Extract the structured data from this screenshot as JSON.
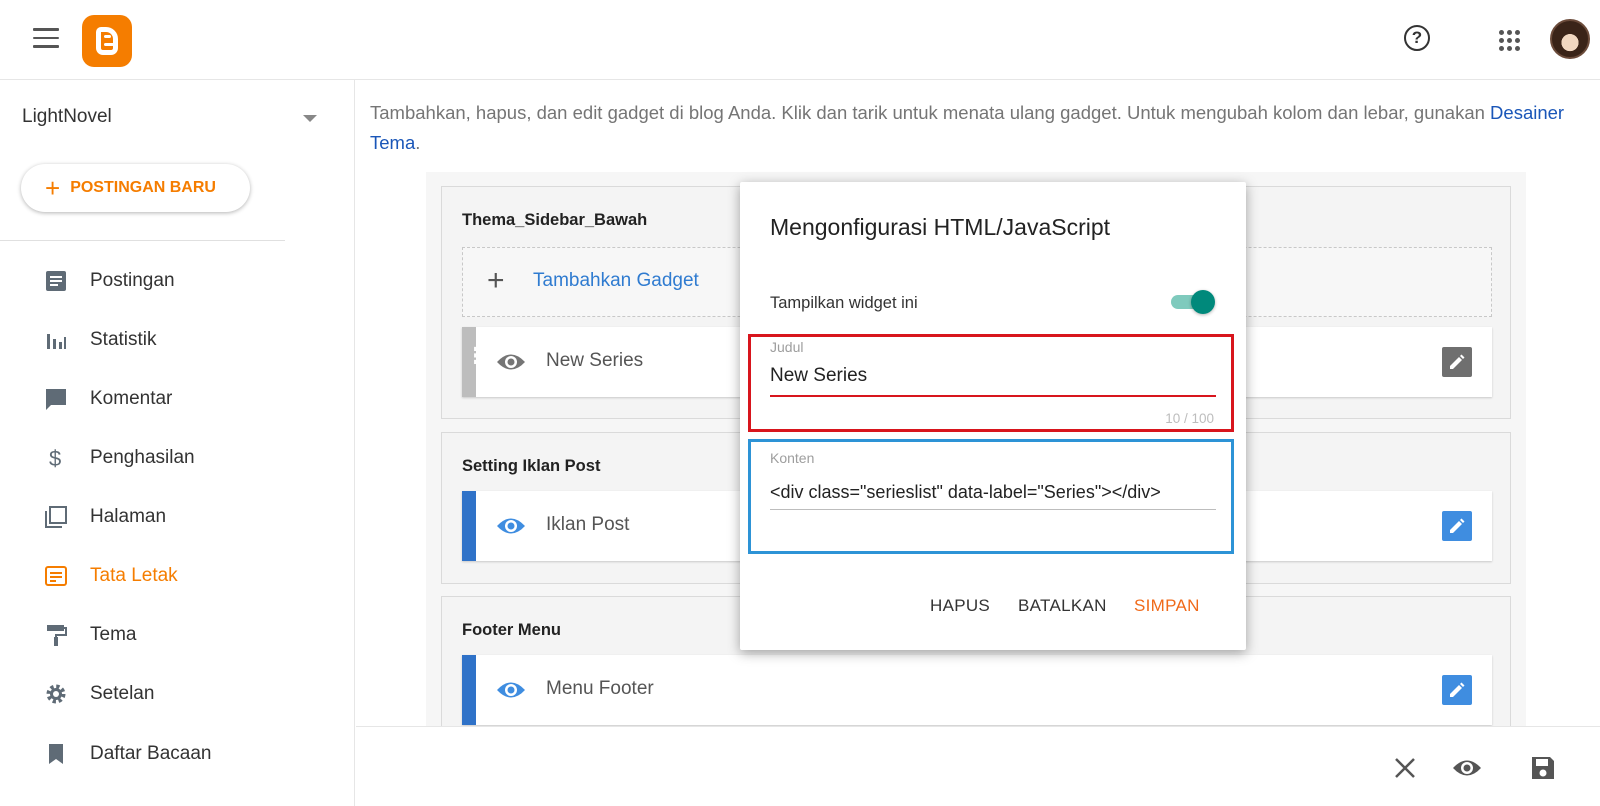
{
  "header": {
    "app_logo": "blogger-logo",
    "help_icon": "help-circle-icon",
    "apps_icon": "apps-grid-icon"
  },
  "sidebar": {
    "blog_name": "LightNovel",
    "new_post_label": "POSTINGAN BARU",
    "items": [
      {
        "label": "Postingan",
        "icon": "posts-icon",
        "active": false
      },
      {
        "label": "Statistik",
        "icon": "stats-icon",
        "active": false
      },
      {
        "label": "Komentar",
        "icon": "comment-icon",
        "active": false
      },
      {
        "label": "Penghasilan",
        "icon": "dollar-icon",
        "active": false
      },
      {
        "label": "Halaman",
        "icon": "pages-icon",
        "active": false
      },
      {
        "label": "Tata Letak",
        "icon": "layout-icon",
        "active": true
      },
      {
        "label": "Tema",
        "icon": "theme-roller-icon",
        "active": false
      },
      {
        "label": "Setelan",
        "icon": "gear-icon",
        "active": false
      },
      {
        "label": "Daftar Bacaan",
        "icon": "bookmark-icon",
        "active": false
      }
    ]
  },
  "main": {
    "intro_text": "Tambahkan, hapus, dan edit gadget di blog Anda. Klik dan tarik untuk menata ulang gadget. Untuk mengubah kolom dan lebar, gunakan ",
    "intro_link": "Desainer Tema",
    "intro_end": ".",
    "sections": [
      {
        "title": "Thema_Sidebar_Bawah",
        "add_gadget_label": "Tambahkan Gadget",
        "gadget": "New Series"
      },
      {
        "title": "Setting Iklan Post",
        "gadget": "Iklan Post"
      },
      {
        "title": "Footer Menu",
        "gadget": "Menu Footer"
      }
    ]
  },
  "dialog": {
    "title": "Mengonfigurasi HTML/JavaScript",
    "toggle_label": "Tampilkan widget ini",
    "toggle_on": true,
    "title_field_label": "Judul",
    "title_field_value": "New Series",
    "title_counter": "10 / 100",
    "content_field_label": "Konten",
    "content_field_value": "<div class=\"serieslist\" data-label=\"Series\"></div>",
    "buttons": {
      "delete": "HAPUS",
      "cancel": "BATALKAN",
      "save": "SIMPAN"
    },
    "colors": {
      "accent": "#f06a1a",
      "toggle": "#00897b",
      "highlight_red": "#d8151d",
      "highlight_blue": "#2d93d6"
    }
  },
  "bottombar": {
    "close_icon": "close-icon",
    "preview_icon": "eye-icon",
    "save_icon": "floppy-save-icon"
  }
}
